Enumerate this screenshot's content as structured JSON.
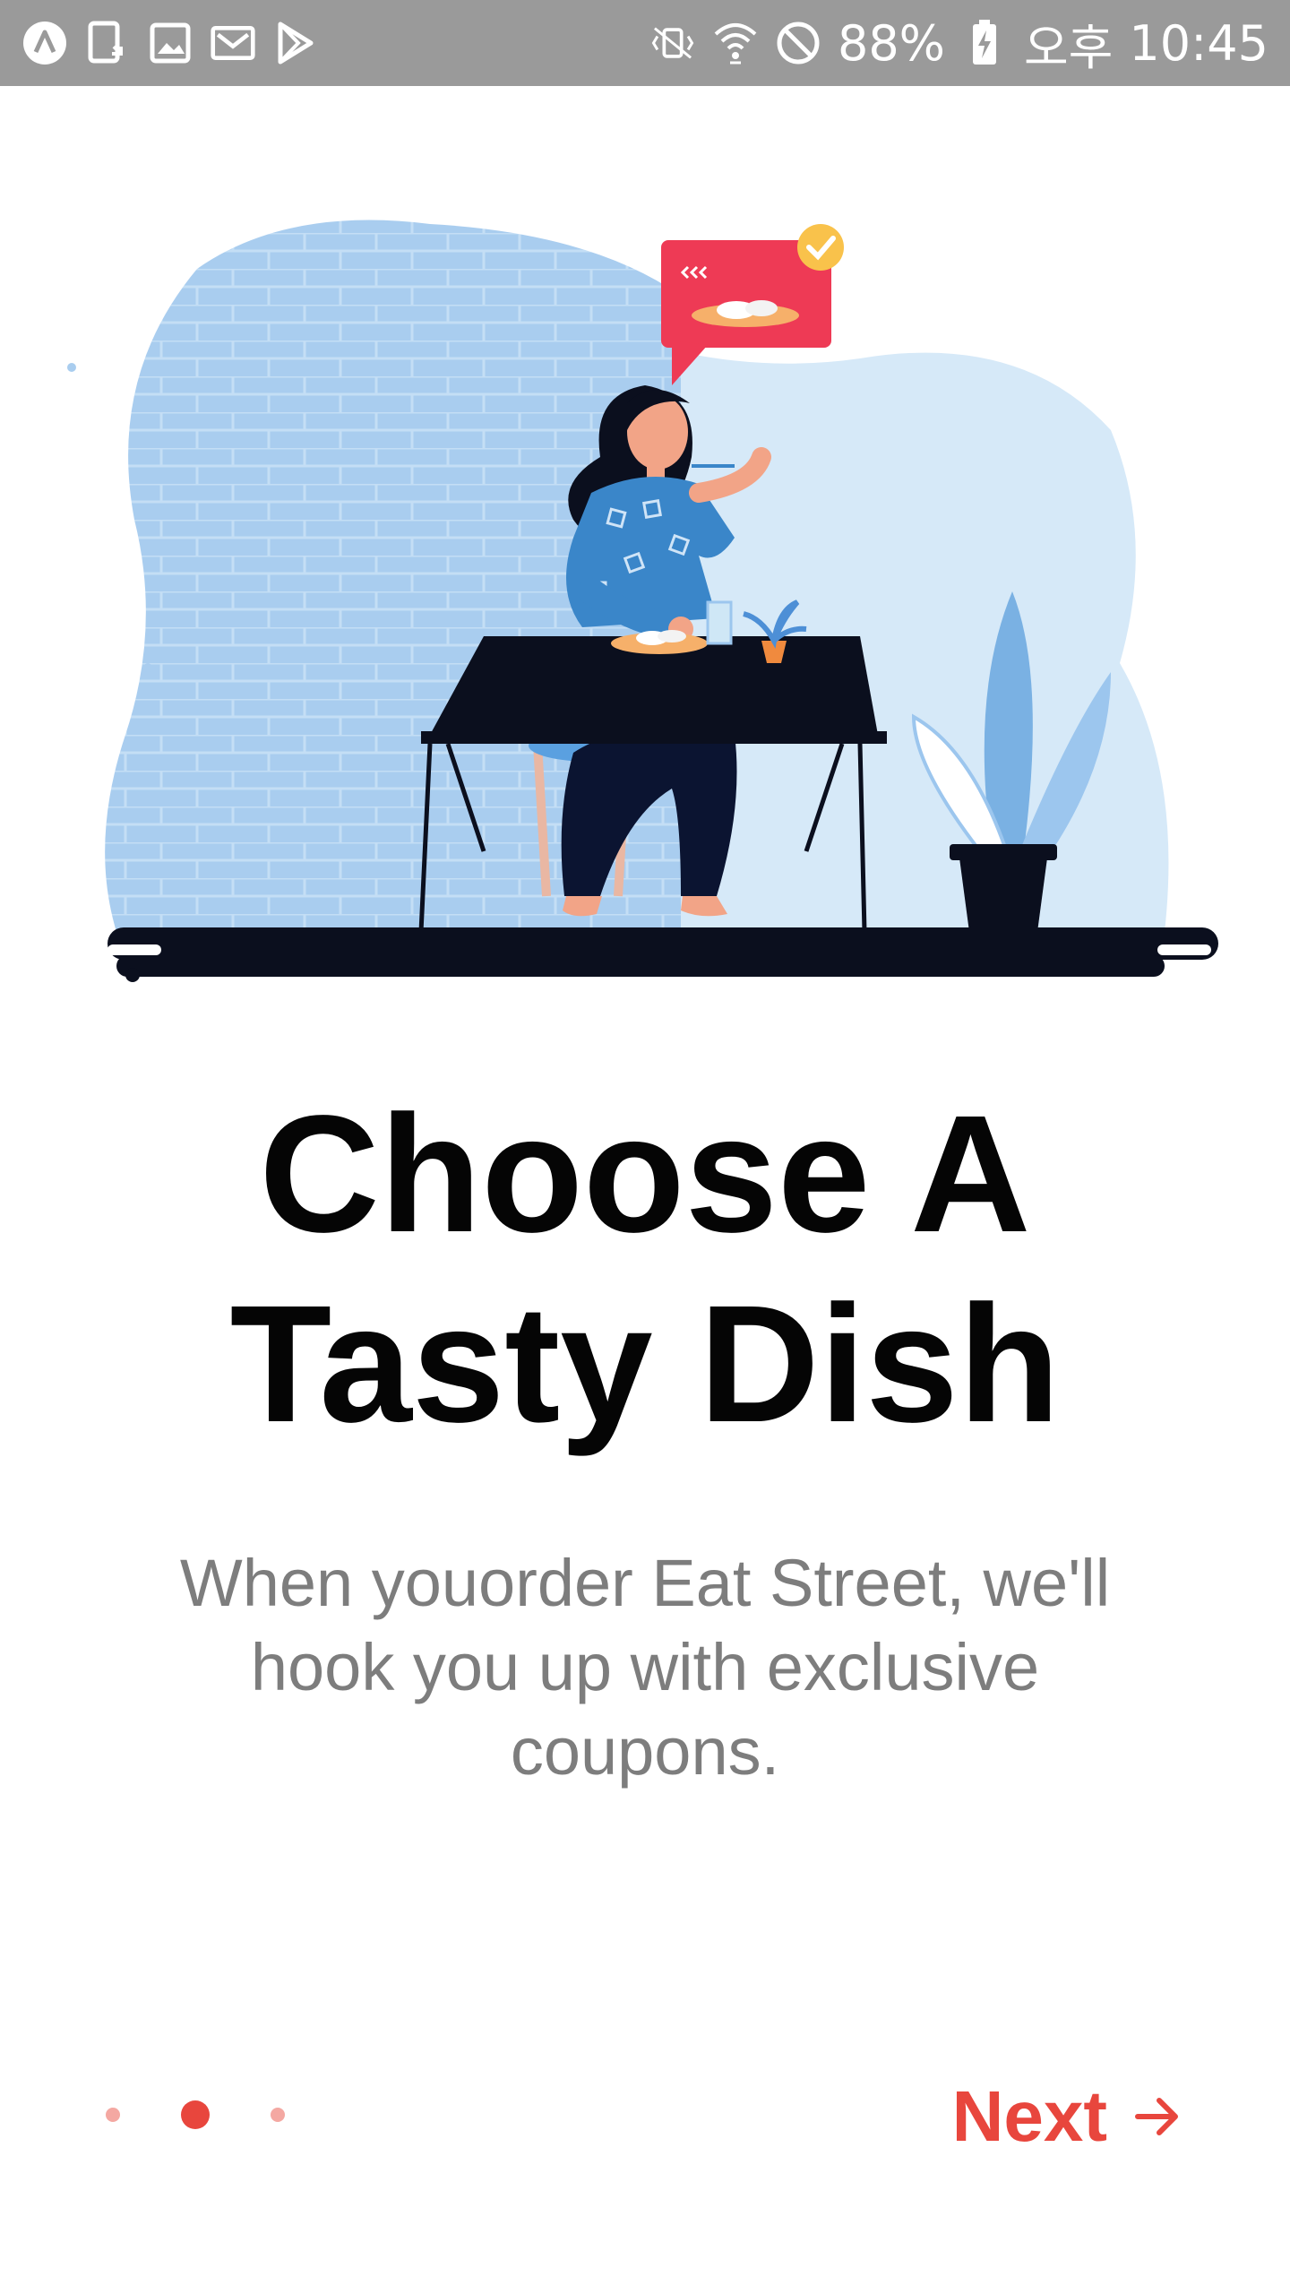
{
  "status_bar": {
    "battery_percent": "88%",
    "time_period": "오후",
    "time": "10:45",
    "icons": [
      "app-launcher-icon",
      "screenshot-notification-icon",
      "gallery-notification-icon",
      "mail-notification-icon",
      "play-store-icon",
      "vibrate-icon",
      "wifi-icon",
      "do-not-disturb-icon",
      "battery-charging-icon"
    ]
  },
  "onboarding": {
    "title_line1": "Choose A",
    "title_line2": "Tasty Dish",
    "description": "When youorder Eat Street, we'll hook you up with exclusive coupons.",
    "illustration": "woman-eating-at-table-illustration"
  },
  "pagination": {
    "page_count": 3,
    "active_index": 1
  },
  "footer": {
    "next_label": "Next",
    "next_icon": "arrow-right-icon"
  },
  "colors": {
    "accent": "#e8463d",
    "accent_light": "#f4a8a2",
    "title": "#050505",
    "body_text": "#7d7d7d",
    "status_bar": "#9a9a9a"
  }
}
